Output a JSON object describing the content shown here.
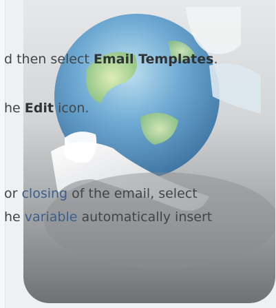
{
  "instructions": {
    "line1": {
      "pre": "d then select ",
      "bold": "Email Templates",
      "post": "."
    },
    "line2": {
      "pre": "he ",
      "bold": "Edit",
      "post": " icon."
    },
    "line3": {
      "pre": " or ",
      "highlight": "closing",
      "post": " of the email, select"
    },
    "line4": {
      "pre": "he ",
      "highlight": "variable",
      "post": " automatically insert"
    }
  },
  "colors": {
    "text": "#404549",
    "highlight_text": "#3b5f8d",
    "globe_blue": "#5c9fd0",
    "globe_green": "#a6cf83"
  },
  "icons": {
    "tile": "globe-email-icon"
  }
}
